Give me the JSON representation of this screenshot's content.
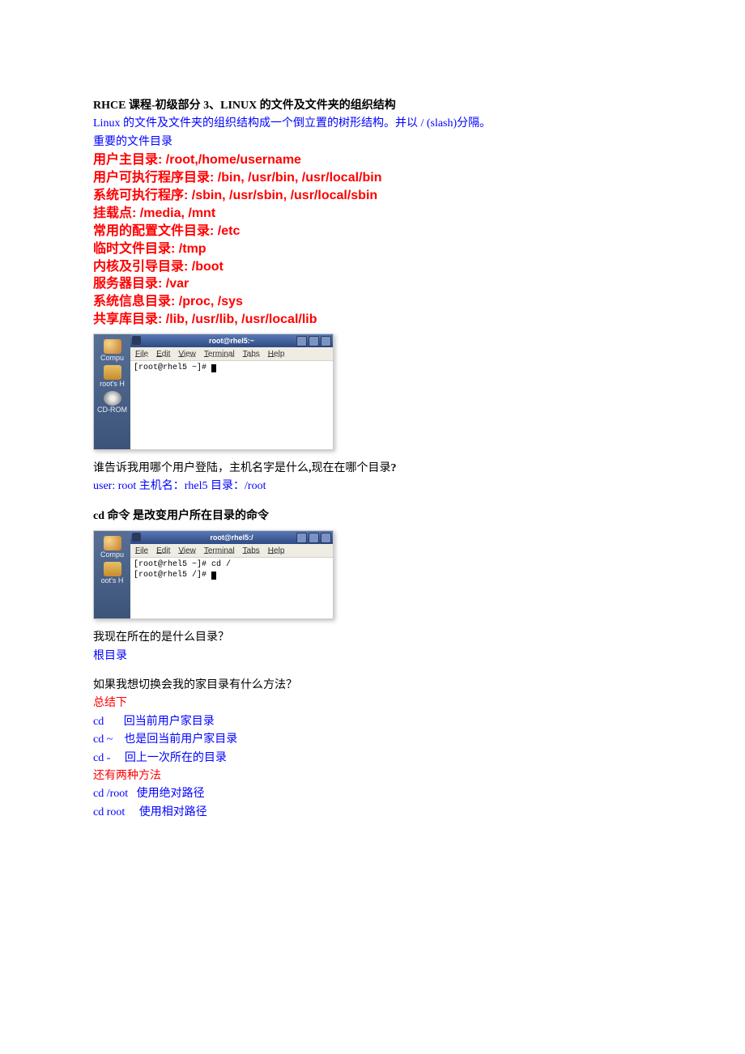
{
  "title_parts": {
    "a": "RHCE",
    "b": " 课程-初级部分 ",
    "c": "3",
    "d": "、",
    "e": "LINUX",
    "f": " 的文件及文件夹的组织结构"
  },
  "intro": {
    "a": "Linux",
    "b": " 的文件及文件夹的组织结构成一个倒立置的树形结构。并以 ",
    "c": "/  (slash)",
    "d": "分隔。"
  },
  "important_heading": "重要的文件目录",
  "dirs": [
    {
      "cn": "用户主目录",
      "en": ": /root,/home/username"
    },
    {
      "cn": "用户可执行程序目录",
      "en": ": /bin, /usr/bin, /usr/local/bin"
    },
    {
      "cn": "系统可执行程序",
      "en": ": /sbin, /usr/sbin, /usr/local/sbin"
    },
    {
      "cn": "挂载点",
      "en": ": /media, /mnt"
    },
    {
      "cn": "常用的配置文件目录",
      "en": ": /etc"
    },
    {
      "cn": "临时文件目录",
      "en": ": /tmp"
    },
    {
      "cn": "内核及引导目录",
      "en": ": /boot"
    },
    {
      "cn": "服务器目录",
      "en": ": /var"
    },
    {
      "cn": "系统信息目录",
      "en": ": /proc, /sys"
    },
    {
      "cn": "共享库目录",
      "en": ": /lib, /usr/lib, /usr/local/lib"
    }
  ],
  "term1": {
    "title": "root@rhel5:~",
    "menu": [
      "File",
      "Edit",
      "View",
      "Terminal",
      "Tabs",
      "Help"
    ],
    "lines": [
      "[root@rhel5 ~]# "
    ],
    "desk": [
      {
        "icon": "comp",
        "label": "Compu"
      },
      {
        "icon": "folder",
        "label": "root's H"
      },
      {
        "icon": "disc",
        "label": "CD-ROM"
      }
    ]
  },
  "q1": {
    "text_a": " 谁告诉我用哪个用户登陆，主机名字是什么",
    "text_b": ",",
    "text_c": "现在在哪个目录",
    "text_d": "?"
  },
  "a1": {
    "a": "user: root ",
    "b": "主机名：",
    "c": "rhel5 ",
    "d": "目录：",
    "e": "/root"
  },
  "cd_heading": {
    "a": "cd ",
    "b": "命令 是改变用户所在目录的命令"
  },
  "term2": {
    "title": "root@rhel5:/",
    "menu": [
      "File",
      "Edit",
      "View",
      "Terminal",
      "Tabs",
      "Help"
    ],
    "lines": [
      "[root@rhel5 ~]# cd /",
      "[root@rhel5 /]# "
    ],
    "desk": [
      {
        "icon": "comp",
        "label": "Compu"
      },
      {
        "icon": "folder",
        "label": "oot's H"
      }
    ]
  },
  "q2": "我现在所在的是什么目录？",
  "a2": "根目录",
  "q3": "如果我想切换会我的家目录有什么方法？",
  "summary_label": "总结下",
  "cd_list": [
    {
      "cmd": "cd",
      "note": "回当前用户家目录",
      "pad": "       "
    },
    {
      "cmd": "cd ~",
      "note": "也是回当前用户家目录",
      "pad": "    "
    },
    {
      "cmd": "cd -",
      "note": "回上一次所在的目录",
      "pad": "     "
    }
  ],
  "more_label": "还有两种方法",
  "cd_list2": [
    {
      "cmd": "cd /root",
      "note": "使用绝对路径",
      "pad": "   "
    },
    {
      "cmd": "cd root",
      "note": "使用相对路径",
      "pad": "     "
    }
  ]
}
